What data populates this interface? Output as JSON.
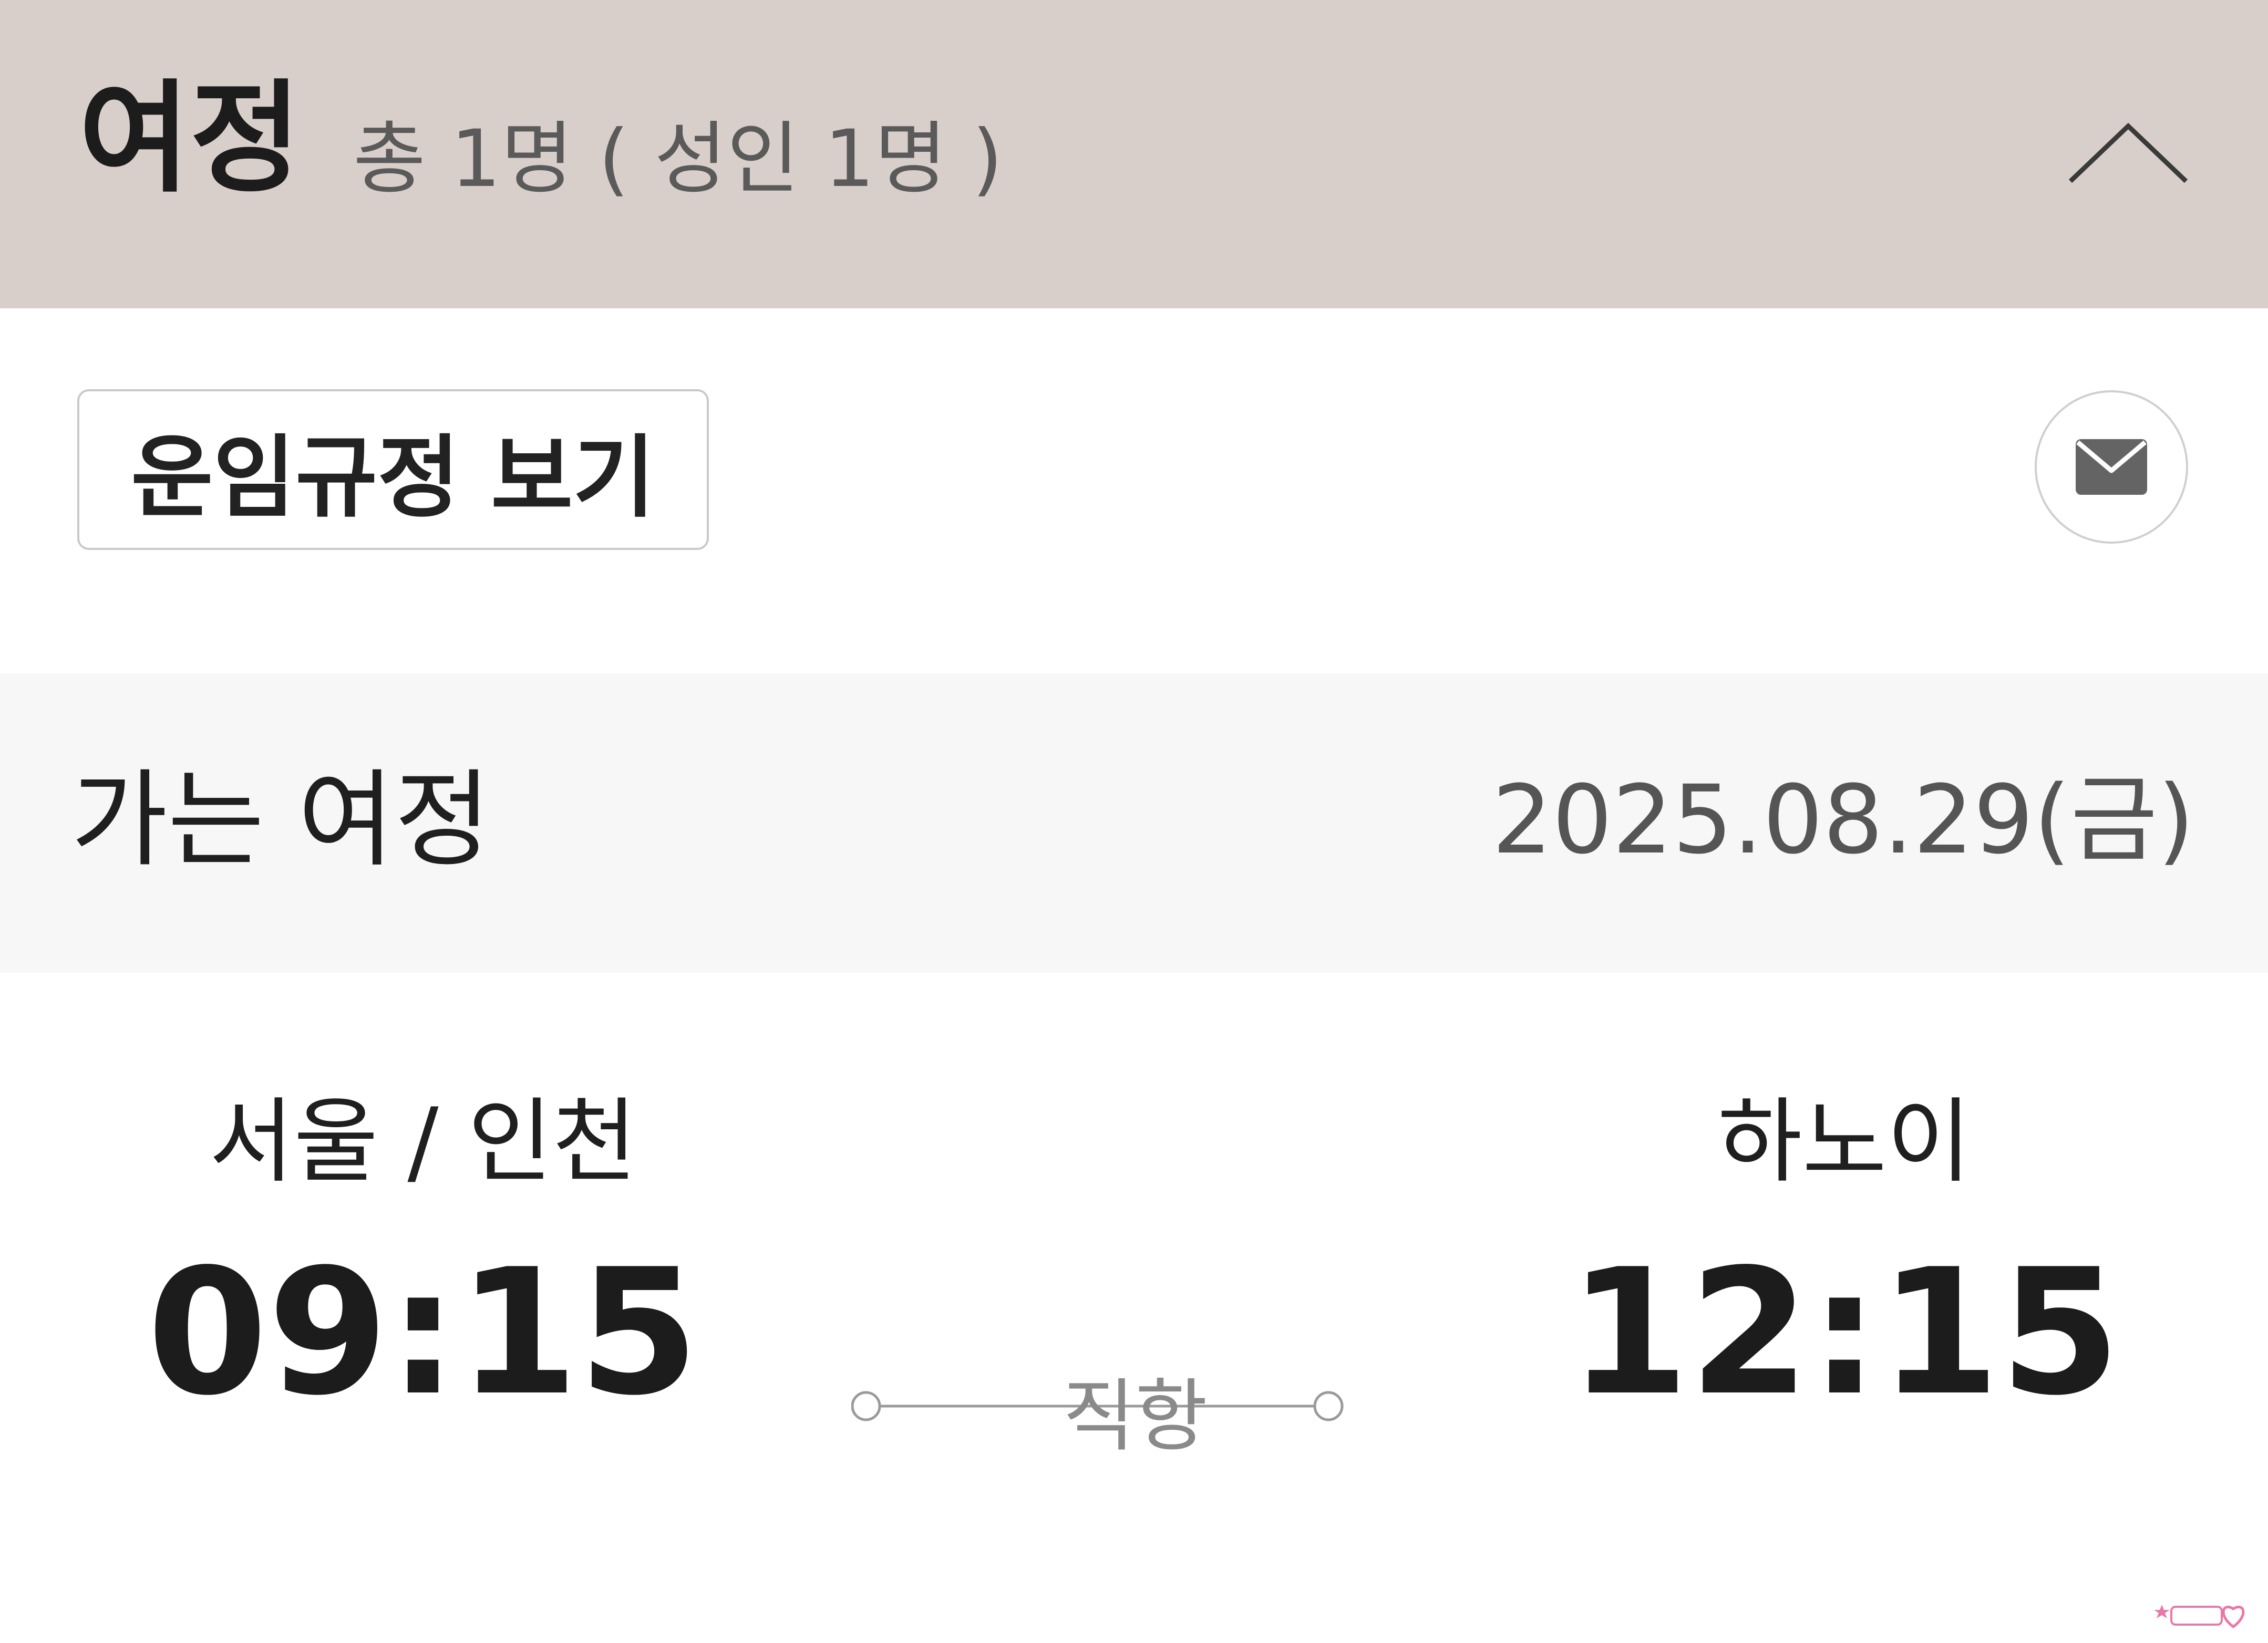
{
  "header": {
    "title": "여정",
    "passenger_summary": "총 1명 ( 성인 1명 )",
    "collapse_icon": "chevron-up-icon"
  },
  "actions": {
    "fare_rules_label": "운임규정 보기",
    "mail_icon": "mail-icon"
  },
  "segment": {
    "label": "가는 여정",
    "date": "2025.08.29(금)"
  },
  "flight": {
    "departure_city": "서울 / 인천",
    "departure_time": "09:15",
    "arrival_city": "하노이",
    "arrival_time": "12:15",
    "route_type": "직항"
  },
  "colors": {
    "header_bg": "#d9cfca",
    "segment_bg": "#f7f7f7",
    "text_primary": "#1c1c1c",
    "text_secondary": "#555555",
    "route_gray": "#8a8a8a"
  }
}
